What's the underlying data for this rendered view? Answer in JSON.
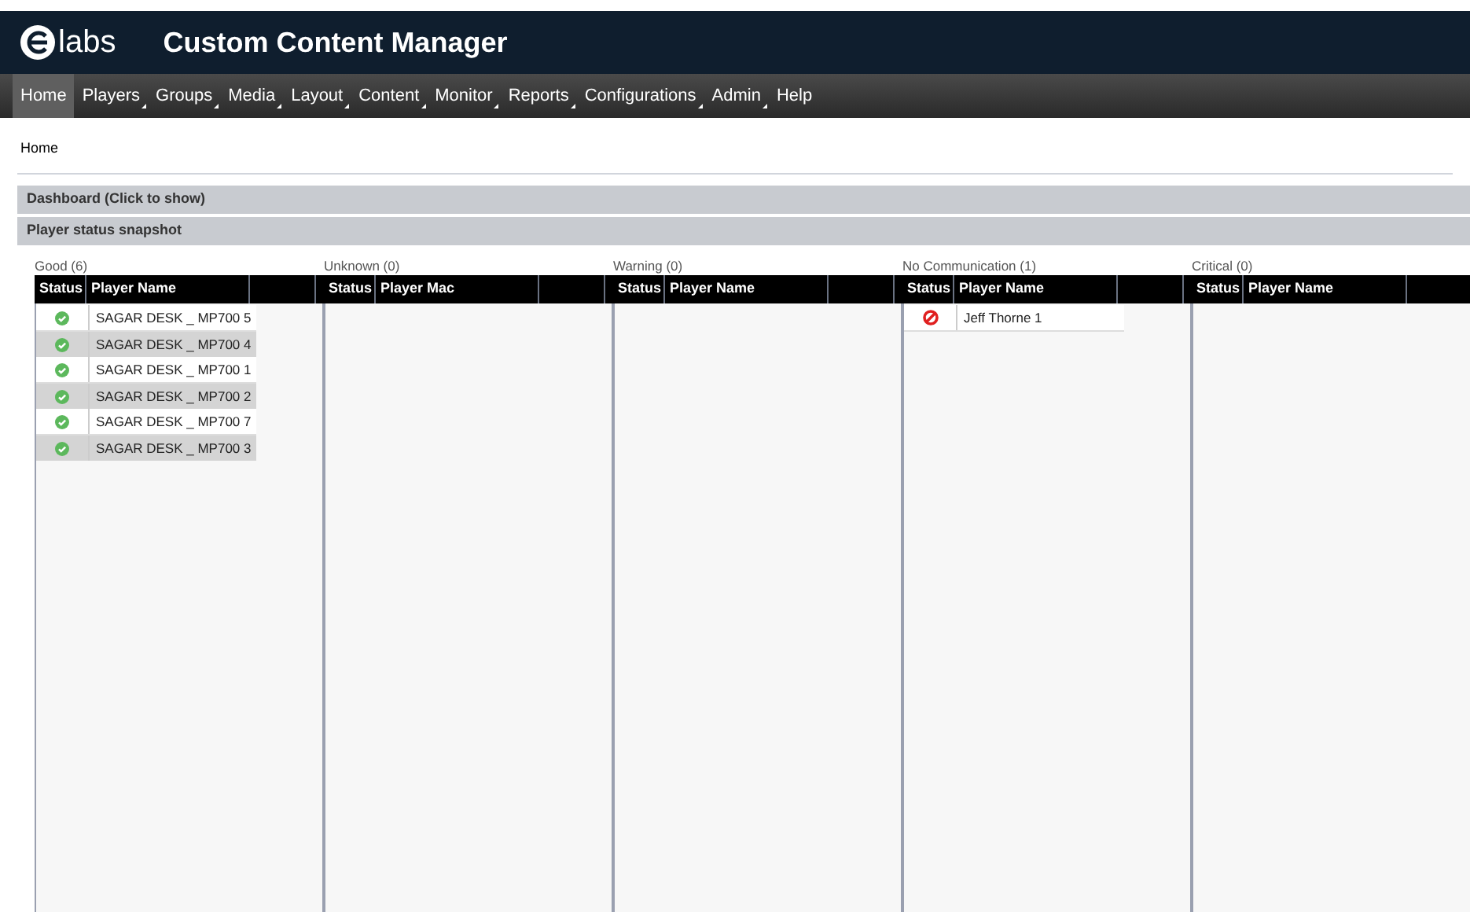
{
  "header": {
    "logo": "labs",
    "title": "Custom Content Manager"
  },
  "nav": [
    {
      "label": "Home",
      "selected": true,
      "has_menu": false
    },
    {
      "label": "Players",
      "selected": false,
      "has_menu": true
    },
    {
      "label": "Groups",
      "selected": false,
      "has_menu": true
    },
    {
      "label": "Media",
      "selected": false,
      "has_menu": true
    },
    {
      "label": "Layout",
      "selected": false,
      "has_menu": true
    },
    {
      "label": "Content",
      "selected": false,
      "has_menu": true
    },
    {
      "label": "Monitor",
      "selected": false,
      "has_menu": true
    },
    {
      "label": "Reports",
      "selected": false,
      "has_menu": true
    },
    {
      "label": "Configurations",
      "selected": false,
      "has_menu": true
    },
    {
      "label": "Admin",
      "selected": false,
      "has_menu": true
    },
    {
      "label": "Help",
      "selected": false,
      "has_menu": false
    }
  ],
  "breadcrumb": "Home",
  "panels": [
    "Dashboard (Click to show)",
    "Player status snapshot"
  ],
  "groups": [
    {
      "title": "Good (6)",
      "columns": [
        "Status",
        "Player Name"
      ],
      "rows": [
        {
          "kind": "ok",
          "name": "SAGAR DESK _ MP700 5"
        },
        {
          "kind": "ok",
          "name": "SAGAR DESK _ MP700 4"
        },
        {
          "kind": "ok",
          "name": "SAGAR DESK _ MP700 1"
        },
        {
          "kind": "ok",
          "name": "SAGAR DESK _ MP700 2"
        },
        {
          "kind": "ok",
          "name": "SAGAR DESK _ MP700 7"
        },
        {
          "kind": "ok",
          "name": "SAGAR DESK _ MP700 3"
        }
      ]
    },
    {
      "title": "Unknown (0)",
      "columns": [
        "Status",
        "Player Mac"
      ]
    },
    {
      "title": "Warning (0)",
      "columns": [
        "Status",
        "Player Name"
      ]
    },
    {
      "title": "No Communication (1)",
      "columns": [
        "Status",
        "Player Name"
      ],
      "rows": [
        {
          "kind": "blocked",
          "name": "Jeff Thorne 1"
        }
      ]
    },
    {
      "title": "Critical (0)",
      "columns": [
        "Status",
        "Player Name"
      ]
    }
  ]
}
